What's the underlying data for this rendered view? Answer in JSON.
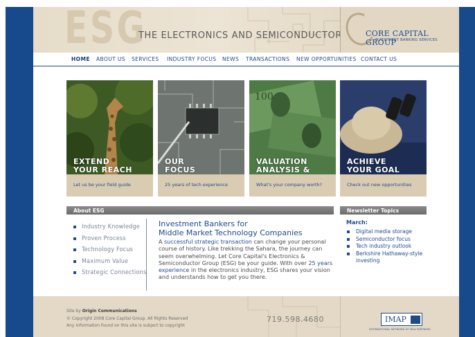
{
  "header": {
    "logo_big": "ESG",
    "title": "THE ELECTRONICS AND SEMICONDUCTOR GROUP",
    "brand_name": "CORE CAPITAL GROUP",
    "brand_sub": "INVESTMENT BANKING SERVICES"
  },
  "nav": {
    "items": [
      {
        "label": "HOME"
      },
      {
        "label": "ABOUT US"
      },
      {
        "label": "SERVICES"
      },
      {
        "label": "INDUSTRY FOCUS"
      },
      {
        "label": "NEWS"
      },
      {
        "label": "TRANSACTIONS"
      },
      {
        "label": "NEW OPPORTUNITIES"
      },
      {
        "label": "CONTACT US"
      }
    ]
  },
  "panels": [
    {
      "line1": "EXTEND",
      "line2": "YOUR REACH",
      "caption": "Let us be your field guide"
    },
    {
      "line1": "OUR",
      "line2": "FOCUS",
      "caption": "25 years of tech experience"
    },
    {
      "line1": "VALUATION",
      "line2": "ANALYSIS & TOOLS",
      "caption": "What's your company worth?"
    },
    {
      "line1": "ACHIEVE",
      "line2": "YOUR GOAL",
      "caption": "Check out new opportunities"
    }
  ],
  "about": {
    "bar_title": "About ESG",
    "items": [
      "Industry Knowledge",
      "Proven Process",
      "Technology Focus",
      "Maximum Value",
      "Strategic Connections"
    ],
    "heading_line1": "Investment Bankers for",
    "heading_line2": "Middle Market Technology Companies",
    "body_a": "A ",
    "body_hl1": "successful strategic transaction",
    "body_b": " can change your personal course of history. Like trekking the Sahara, the journey can seem overwhelming. Let Core Capital's Electronics & Semiconductor Group (ESG) be your guide. With over ",
    "body_hl2": "25 years experience",
    "body_c": " in the electronics industry, ESG shares your vision and understands how to get you there."
  },
  "newsletter": {
    "bar_title": "Newsletter Topics",
    "label": "March:",
    "items": [
      "Digital media storage",
      "Semiconductor focus",
      "Tech industry outlook",
      "Berkshire Hathaway-style investing"
    ]
  },
  "footer": {
    "copyright": "© Copyright 2008 Core Capital Group. All Rights Reserved",
    "disclaimer": "Any information found on this site is subject to copyright",
    "credit_prefix": "Site by ",
    "credit_name": "Origin Communications",
    "phone": "719.598.4680",
    "imap_logo": "IMAP",
    "imap_sub": "INTERNATIONAL NETWORK OF M&A PARTNERS"
  }
}
